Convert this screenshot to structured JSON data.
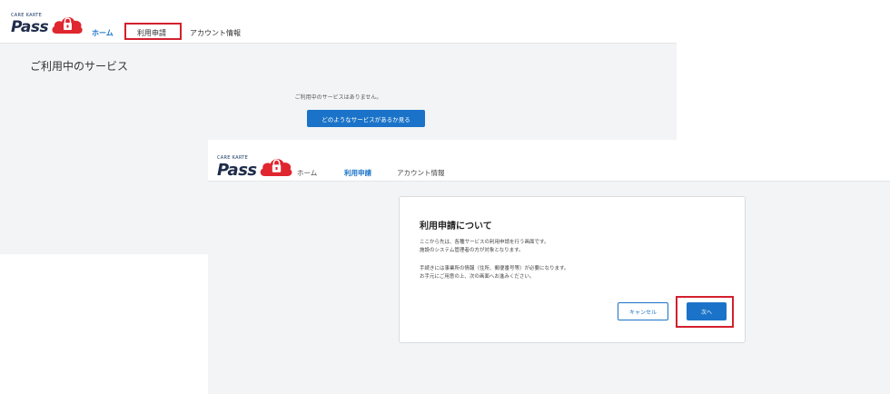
{
  "back_screen": {
    "logo": {
      "small_text": "CARE KARTE",
      "word": "Pass"
    },
    "nav": {
      "home": "ホーム",
      "apply": "利用申請",
      "account": "アカウント情報"
    },
    "section_title": "ご利用中のサービス",
    "empty_message": "ご利用中のサービスはありません。",
    "cta_button": "どのようなサービスがあるか見る"
  },
  "front_screen": {
    "logo": {
      "small_text": "CARE KARTE",
      "word": "Pass"
    },
    "nav": {
      "home": "ホーム",
      "apply": "利用申請",
      "account": "アカウント情報"
    },
    "modal": {
      "title": "利用申請について",
      "line1": "ここから先は、各種サービスの利用申請を行う画面です。",
      "line2": "施設のシステム管理者の方が対象となります。",
      "line3": "手続きには事業所の情報（住所、郵便番号等）が必要になります。",
      "line4": "お手元にご用意の上、次の画面へお進みください。",
      "cancel_button": "キャンセル",
      "next_button": "次へ"
    }
  },
  "colors": {
    "accent": "#1a73c8",
    "highlight": "#d3202f",
    "logo_red": "#e0262f",
    "background": "#f3f4f6"
  },
  "icons": {
    "logo_cloud": "cloud-lock-icon"
  }
}
